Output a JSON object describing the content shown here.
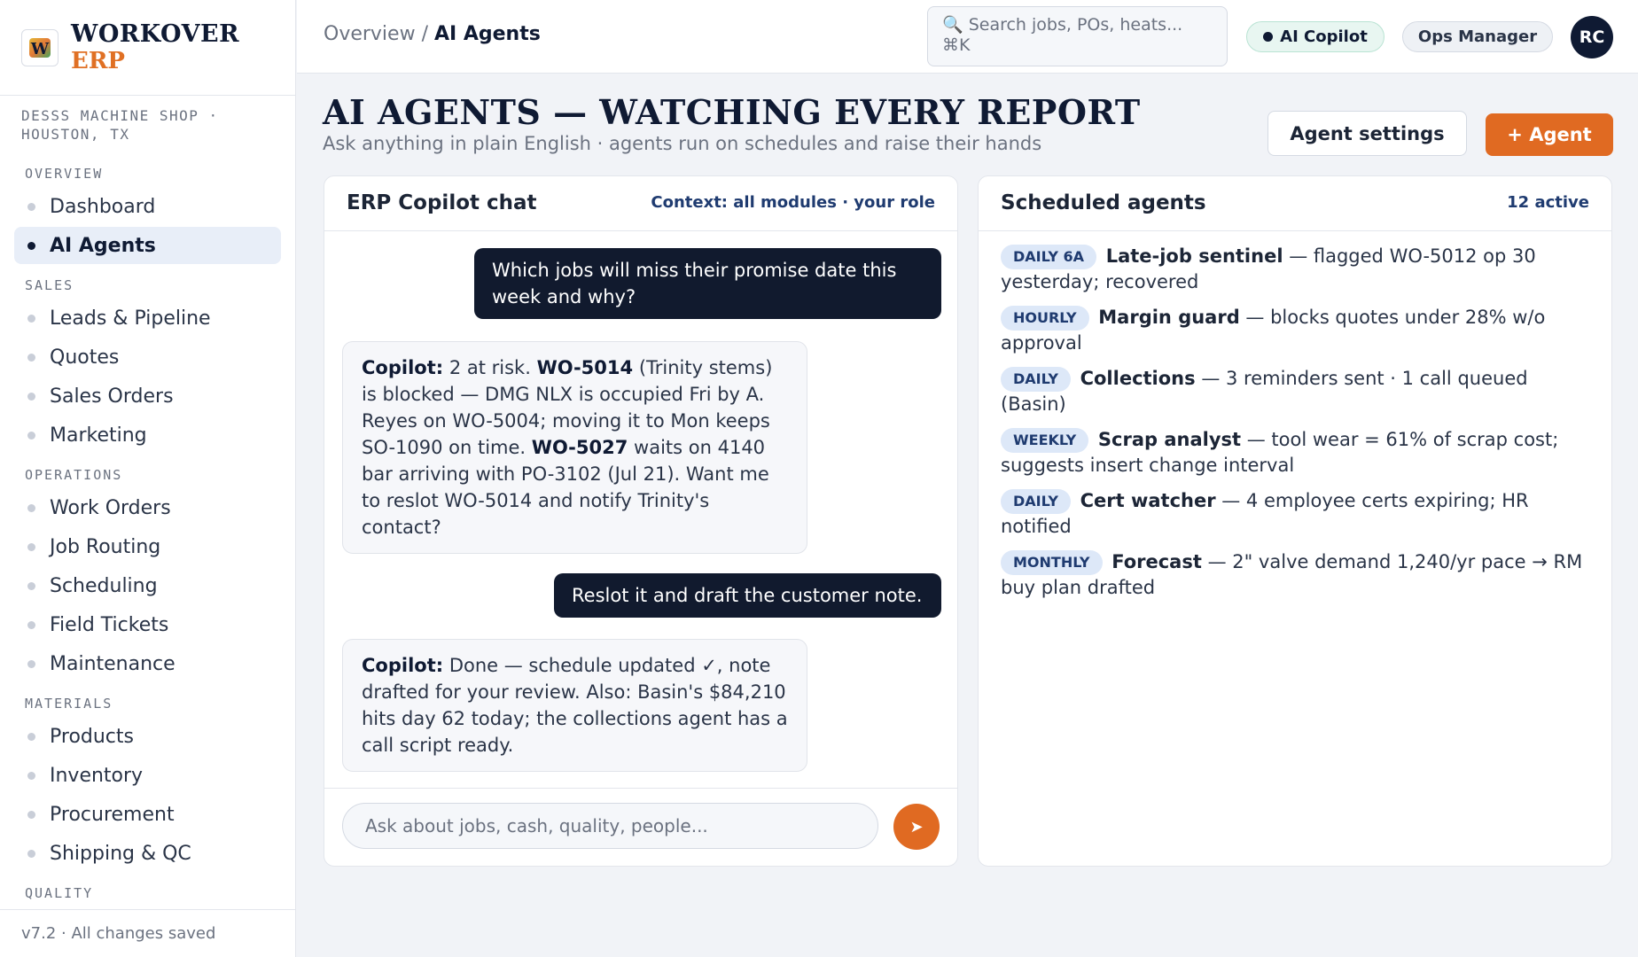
{
  "brand": {
    "logo_letter": "W",
    "name": "WORKOVER",
    "sub": "ERP"
  },
  "company": "DESSS MACHINE SHOP · HOUSTON, TX",
  "nav": {
    "overview": {
      "section": "OVERVIEW",
      "items": [
        "Dashboard",
        "AI Agents"
      ]
    },
    "sales": {
      "section": "SALES",
      "items": [
        "Leads & Pipeline",
        "Quotes",
        "Sales Orders",
        "Marketing"
      ]
    },
    "operations": {
      "section": "OPERATIONS",
      "items": [
        "Work Orders",
        "Job Routing",
        "Scheduling",
        "Field Tickets",
        "Maintenance"
      ]
    },
    "materials": {
      "section": "MATERIALS",
      "items": [
        "Products",
        "Inventory",
        "Procurement",
        "Shipping & QC"
      ]
    },
    "quality": {
      "section": "QUALITY"
    },
    "active_item": "AI Agents"
  },
  "footer": "v7.2 · All changes saved",
  "header": {
    "breadcrumb_parent": "Overview /",
    "breadcrumb_current": "AI Agents",
    "search_placeholder": "🔍 Search jobs, POs, heats... ⌘K",
    "copilot_label": "AI Copilot",
    "role_label": "Ops Manager",
    "avatar_initials": "RC"
  },
  "page": {
    "title": "AI AGENTS — WATCHING EVERY REPORT",
    "subtitle": "Ask anything in plain English · agents run on schedules and raise their hands",
    "settings_button": "Agent settings",
    "add_button": "+ Agent"
  },
  "chat": {
    "title": "ERP Copilot chat",
    "context": "Context: all modules · your role",
    "msg1": "Which jobs will miss their promise date this week and why?",
    "reply1": {
      "label": "Copilot:",
      "t1": " 2 at risk. ",
      "wo1": "WO-5014",
      "t2": " (Trinity stems) is blocked — DMG NLX is occupied Fri by A. Reyes on WO-5004; moving it to Mon keeps SO-1090 on time. ",
      "wo2": "WO-5027",
      "t3": " waits on 4140 bar arriving with PO-3102 (Jul 21). Want me to reslot WO-5014 and notify Trinity's contact?"
    },
    "msg2": "Reslot it and draft the customer note.",
    "reply2": {
      "label": "Copilot:",
      "text": " Done — schedule updated ✓, note drafted for your review. Also: Basin's $84,210 hits day 62 today; the collections agent has a call script ready."
    },
    "input_placeholder": "Ask about jobs, cash, quality, people...",
    "send_icon": "➤"
  },
  "agents": {
    "title": "Scheduled agents",
    "count": "12 active",
    "items": [
      {
        "badge": "DAILY 6A",
        "name": "Late-job sentinel",
        "desc": " — flagged WO-5012 op 30 yesterday; recovered"
      },
      {
        "badge": "HOURLY",
        "name": "Margin guard",
        "desc": " — blocks quotes under 28% w/o approval"
      },
      {
        "badge": "DAILY",
        "name": "Collections",
        "desc": " — 3 reminders sent · 1 call queued (Basin)"
      },
      {
        "badge": "WEEKLY",
        "name": "Scrap analyst",
        "desc": " — tool wear = 61% of scrap cost; suggests insert change interval"
      },
      {
        "badge": "DAILY",
        "name": "Cert watcher",
        "desc": " — 4 employee certs expiring; HR notified"
      },
      {
        "badge": "MONTHLY",
        "name": "Forecast",
        "desc": " — 2\" valve demand 1,240/yr pace → RM buy plan drafted"
      }
    ]
  }
}
